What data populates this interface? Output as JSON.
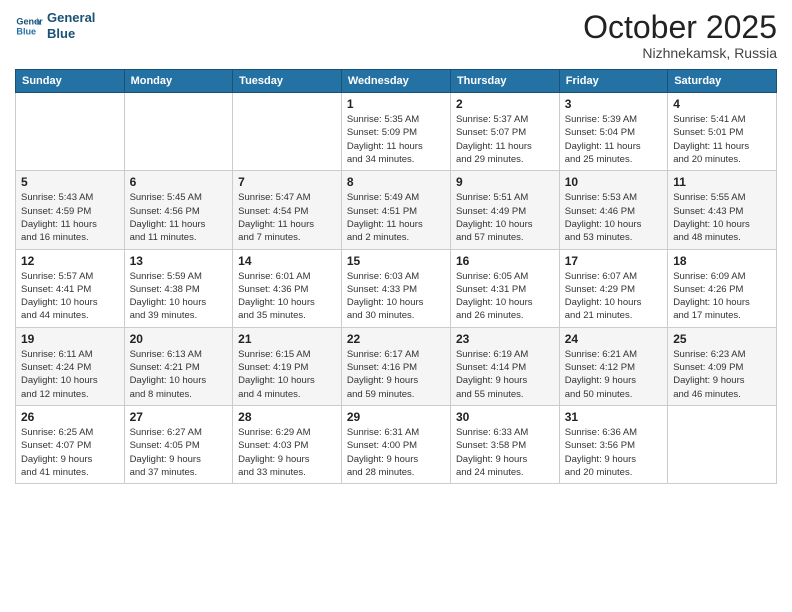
{
  "header": {
    "logo_line1": "General",
    "logo_line2": "Blue",
    "month": "October 2025",
    "location": "Nizhnekamsk, Russia"
  },
  "days_of_week": [
    "Sunday",
    "Monday",
    "Tuesday",
    "Wednesday",
    "Thursday",
    "Friday",
    "Saturday"
  ],
  "weeks": [
    [
      {
        "day": "",
        "info": ""
      },
      {
        "day": "",
        "info": ""
      },
      {
        "day": "",
        "info": ""
      },
      {
        "day": "1",
        "info": "Sunrise: 5:35 AM\nSunset: 5:09 PM\nDaylight: 11 hours\nand 34 minutes."
      },
      {
        "day": "2",
        "info": "Sunrise: 5:37 AM\nSunset: 5:07 PM\nDaylight: 11 hours\nand 29 minutes."
      },
      {
        "day": "3",
        "info": "Sunrise: 5:39 AM\nSunset: 5:04 PM\nDaylight: 11 hours\nand 25 minutes."
      },
      {
        "day": "4",
        "info": "Sunrise: 5:41 AM\nSunset: 5:01 PM\nDaylight: 11 hours\nand 20 minutes."
      }
    ],
    [
      {
        "day": "5",
        "info": "Sunrise: 5:43 AM\nSunset: 4:59 PM\nDaylight: 11 hours\nand 16 minutes."
      },
      {
        "day": "6",
        "info": "Sunrise: 5:45 AM\nSunset: 4:56 PM\nDaylight: 11 hours\nand 11 minutes."
      },
      {
        "day": "7",
        "info": "Sunrise: 5:47 AM\nSunset: 4:54 PM\nDaylight: 11 hours\nand 7 minutes."
      },
      {
        "day": "8",
        "info": "Sunrise: 5:49 AM\nSunset: 4:51 PM\nDaylight: 11 hours\nand 2 minutes."
      },
      {
        "day": "9",
        "info": "Sunrise: 5:51 AM\nSunset: 4:49 PM\nDaylight: 10 hours\nand 57 minutes."
      },
      {
        "day": "10",
        "info": "Sunrise: 5:53 AM\nSunset: 4:46 PM\nDaylight: 10 hours\nand 53 minutes."
      },
      {
        "day": "11",
        "info": "Sunrise: 5:55 AM\nSunset: 4:43 PM\nDaylight: 10 hours\nand 48 minutes."
      }
    ],
    [
      {
        "day": "12",
        "info": "Sunrise: 5:57 AM\nSunset: 4:41 PM\nDaylight: 10 hours\nand 44 minutes."
      },
      {
        "day": "13",
        "info": "Sunrise: 5:59 AM\nSunset: 4:38 PM\nDaylight: 10 hours\nand 39 minutes."
      },
      {
        "day": "14",
        "info": "Sunrise: 6:01 AM\nSunset: 4:36 PM\nDaylight: 10 hours\nand 35 minutes."
      },
      {
        "day": "15",
        "info": "Sunrise: 6:03 AM\nSunset: 4:33 PM\nDaylight: 10 hours\nand 30 minutes."
      },
      {
        "day": "16",
        "info": "Sunrise: 6:05 AM\nSunset: 4:31 PM\nDaylight: 10 hours\nand 26 minutes."
      },
      {
        "day": "17",
        "info": "Sunrise: 6:07 AM\nSunset: 4:29 PM\nDaylight: 10 hours\nand 21 minutes."
      },
      {
        "day": "18",
        "info": "Sunrise: 6:09 AM\nSunset: 4:26 PM\nDaylight: 10 hours\nand 17 minutes."
      }
    ],
    [
      {
        "day": "19",
        "info": "Sunrise: 6:11 AM\nSunset: 4:24 PM\nDaylight: 10 hours\nand 12 minutes."
      },
      {
        "day": "20",
        "info": "Sunrise: 6:13 AM\nSunset: 4:21 PM\nDaylight: 10 hours\nand 8 minutes."
      },
      {
        "day": "21",
        "info": "Sunrise: 6:15 AM\nSunset: 4:19 PM\nDaylight: 10 hours\nand 4 minutes."
      },
      {
        "day": "22",
        "info": "Sunrise: 6:17 AM\nSunset: 4:16 PM\nDaylight: 9 hours\nand 59 minutes."
      },
      {
        "day": "23",
        "info": "Sunrise: 6:19 AM\nSunset: 4:14 PM\nDaylight: 9 hours\nand 55 minutes."
      },
      {
        "day": "24",
        "info": "Sunrise: 6:21 AM\nSunset: 4:12 PM\nDaylight: 9 hours\nand 50 minutes."
      },
      {
        "day": "25",
        "info": "Sunrise: 6:23 AM\nSunset: 4:09 PM\nDaylight: 9 hours\nand 46 minutes."
      }
    ],
    [
      {
        "day": "26",
        "info": "Sunrise: 6:25 AM\nSunset: 4:07 PM\nDaylight: 9 hours\nand 41 minutes."
      },
      {
        "day": "27",
        "info": "Sunrise: 6:27 AM\nSunset: 4:05 PM\nDaylight: 9 hours\nand 37 minutes."
      },
      {
        "day": "28",
        "info": "Sunrise: 6:29 AM\nSunset: 4:03 PM\nDaylight: 9 hours\nand 33 minutes."
      },
      {
        "day": "29",
        "info": "Sunrise: 6:31 AM\nSunset: 4:00 PM\nDaylight: 9 hours\nand 28 minutes."
      },
      {
        "day": "30",
        "info": "Sunrise: 6:33 AM\nSunset: 3:58 PM\nDaylight: 9 hours\nand 24 minutes."
      },
      {
        "day": "31",
        "info": "Sunrise: 6:36 AM\nSunset: 3:56 PM\nDaylight: 9 hours\nand 20 minutes."
      },
      {
        "day": "",
        "info": ""
      }
    ]
  ]
}
